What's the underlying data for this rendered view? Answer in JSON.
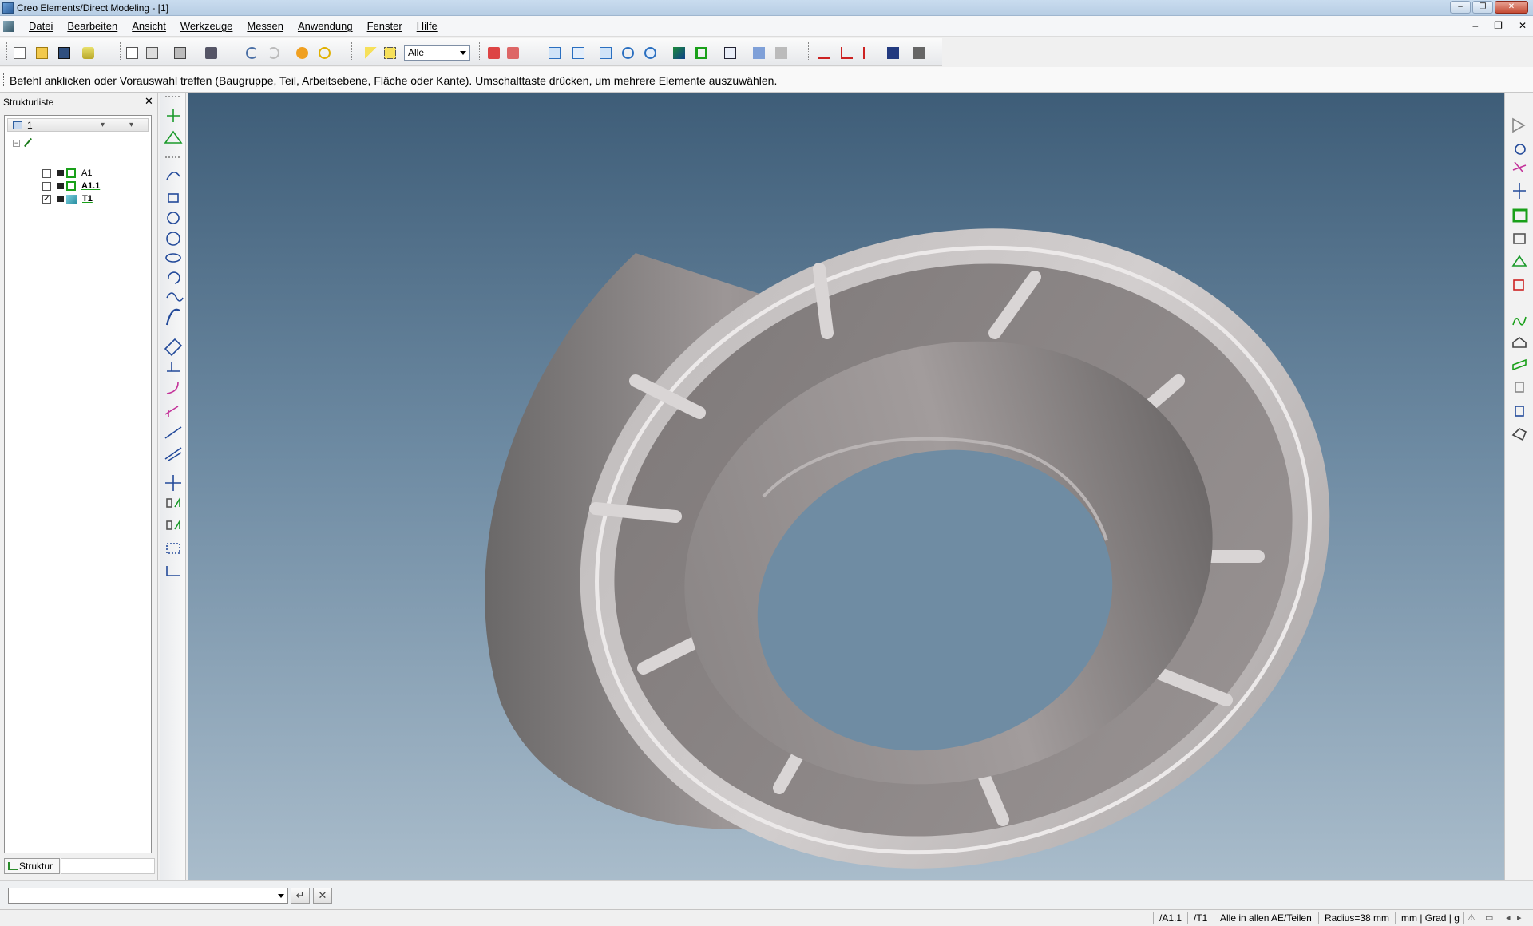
{
  "window": {
    "title": "Creo Elements/Direct Modeling - [1]",
    "buttons": [
      "–",
      "❐",
      "✕"
    ]
  },
  "menubar": {
    "items": [
      "Datei",
      "Bearbeiten",
      "Ansicht",
      "Werkzeuge",
      "Messen",
      "Anwendung",
      "Fenster",
      "Hilfe"
    ],
    "mdi_buttons": [
      "–",
      "❐",
      "✕"
    ]
  },
  "toolbar": {
    "select_filter": "Alle"
  },
  "prompt": {
    "text": "Befehl anklicken oder Vorauswahl treffen (Baugruppe, Teil, Arbeitsebene, Fläche oder Kante). Umschalttaste drücken, um mehrere Elemente auszuwählen."
  },
  "structure_panel": {
    "title": "Strukturliste",
    "close": "✕",
    "header_value": "1",
    "items": [
      {
        "label": "A1",
        "checked": false,
        "type": "assembly",
        "bold": false
      },
      {
        "label": "A1.1",
        "checked": false,
        "type": "assembly",
        "bold": true
      },
      {
        "label": "T1",
        "checked": true,
        "type": "part",
        "bold": true
      }
    ],
    "tab_label": "Struktur"
  },
  "command_line": {
    "value": "",
    "enter": "↵",
    "cancel": "✕"
  },
  "status": {
    "active_assembly": "/A1.1",
    "active_part": "/T1",
    "selection_scope": "Alle in allen AE/Teilen",
    "radius": "Radius=38 mm",
    "units": "mm | Grad | g"
  },
  "colors": {
    "viewport_top": "#3e5d78",
    "viewport_bottom": "#a9bccb",
    "part": "#8e8888",
    "accent_green": "#19a019"
  }
}
